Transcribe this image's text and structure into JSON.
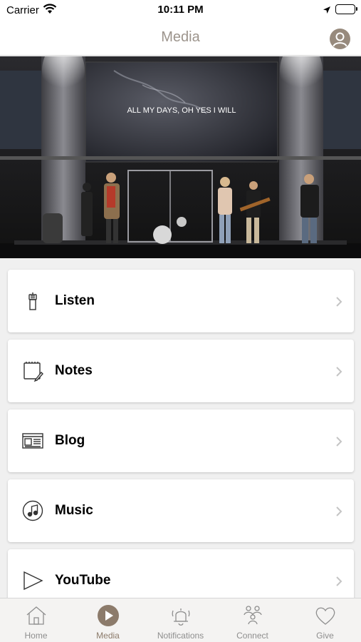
{
  "status_bar": {
    "carrier": "Carrier",
    "time": "10:11 PM"
  },
  "nav": {
    "title": "Media"
  },
  "hero": {
    "screen_text": "ALL MY DAYS, OH YES I WILL"
  },
  "menu": [
    {
      "label": "Listen",
      "icon": "microphone-icon"
    },
    {
      "label": "Notes",
      "icon": "notes-icon"
    },
    {
      "label": "Blog",
      "icon": "newspaper-icon"
    },
    {
      "label": "Music",
      "icon": "music-note-icon"
    },
    {
      "label": "YouTube",
      "icon": "play-icon"
    }
  ],
  "tabs": [
    {
      "label": "Home",
      "icon": "home-icon"
    },
    {
      "label": "Media",
      "icon": "media-play-icon",
      "active": true
    },
    {
      "label": "Notifications",
      "icon": "bell-icon"
    },
    {
      "label": "Connect",
      "icon": "people-icon"
    },
    {
      "label": "Give",
      "icon": "heart-icon"
    }
  ],
  "colors": {
    "accent": "#8c7b6b",
    "title": "#9c948c",
    "tab_inactive": "#8e8e8e"
  }
}
